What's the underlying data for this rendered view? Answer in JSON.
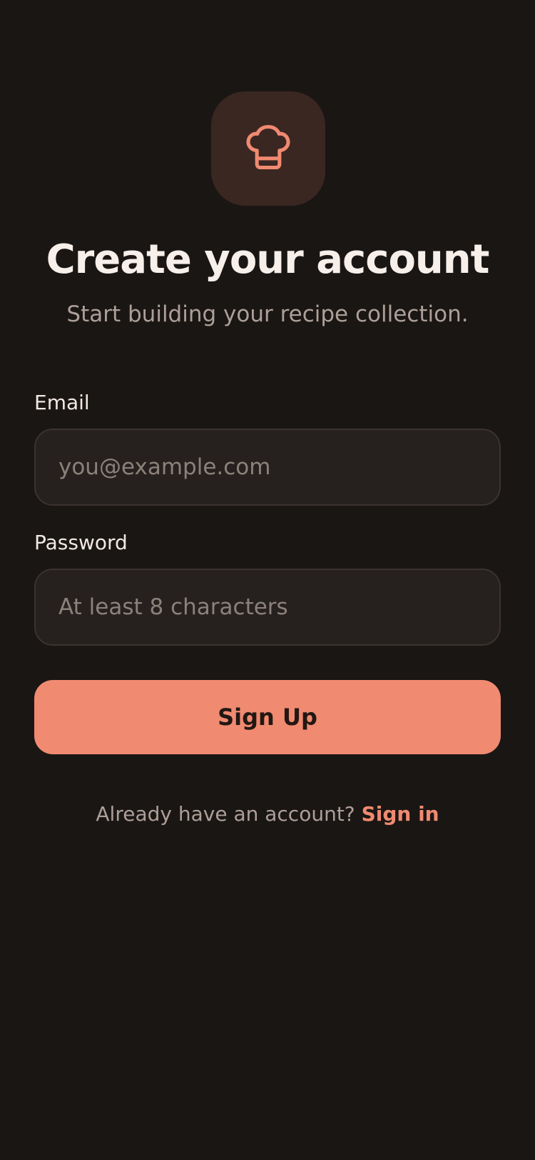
{
  "app": {
    "logo_icon": "chef-hat-icon",
    "accent_color": "#f08a71"
  },
  "header": {
    "title": "Create your account",
    "subtitle": "Start building your recipe collection."
  },
  "form": {
    "email": {
      "label": "Email",
      "value": "",
      "placeholder": "you@example.com"
    },
    "password": {
      "label": "Password",
      "value": "",
      "placeholder": "At least 8 characters"
    },
    "submit_label": "Sign Up"
  },
  "footer": {
    "prompt": "Already have an account?",
    "link_label": "Sign in"
  }
}
